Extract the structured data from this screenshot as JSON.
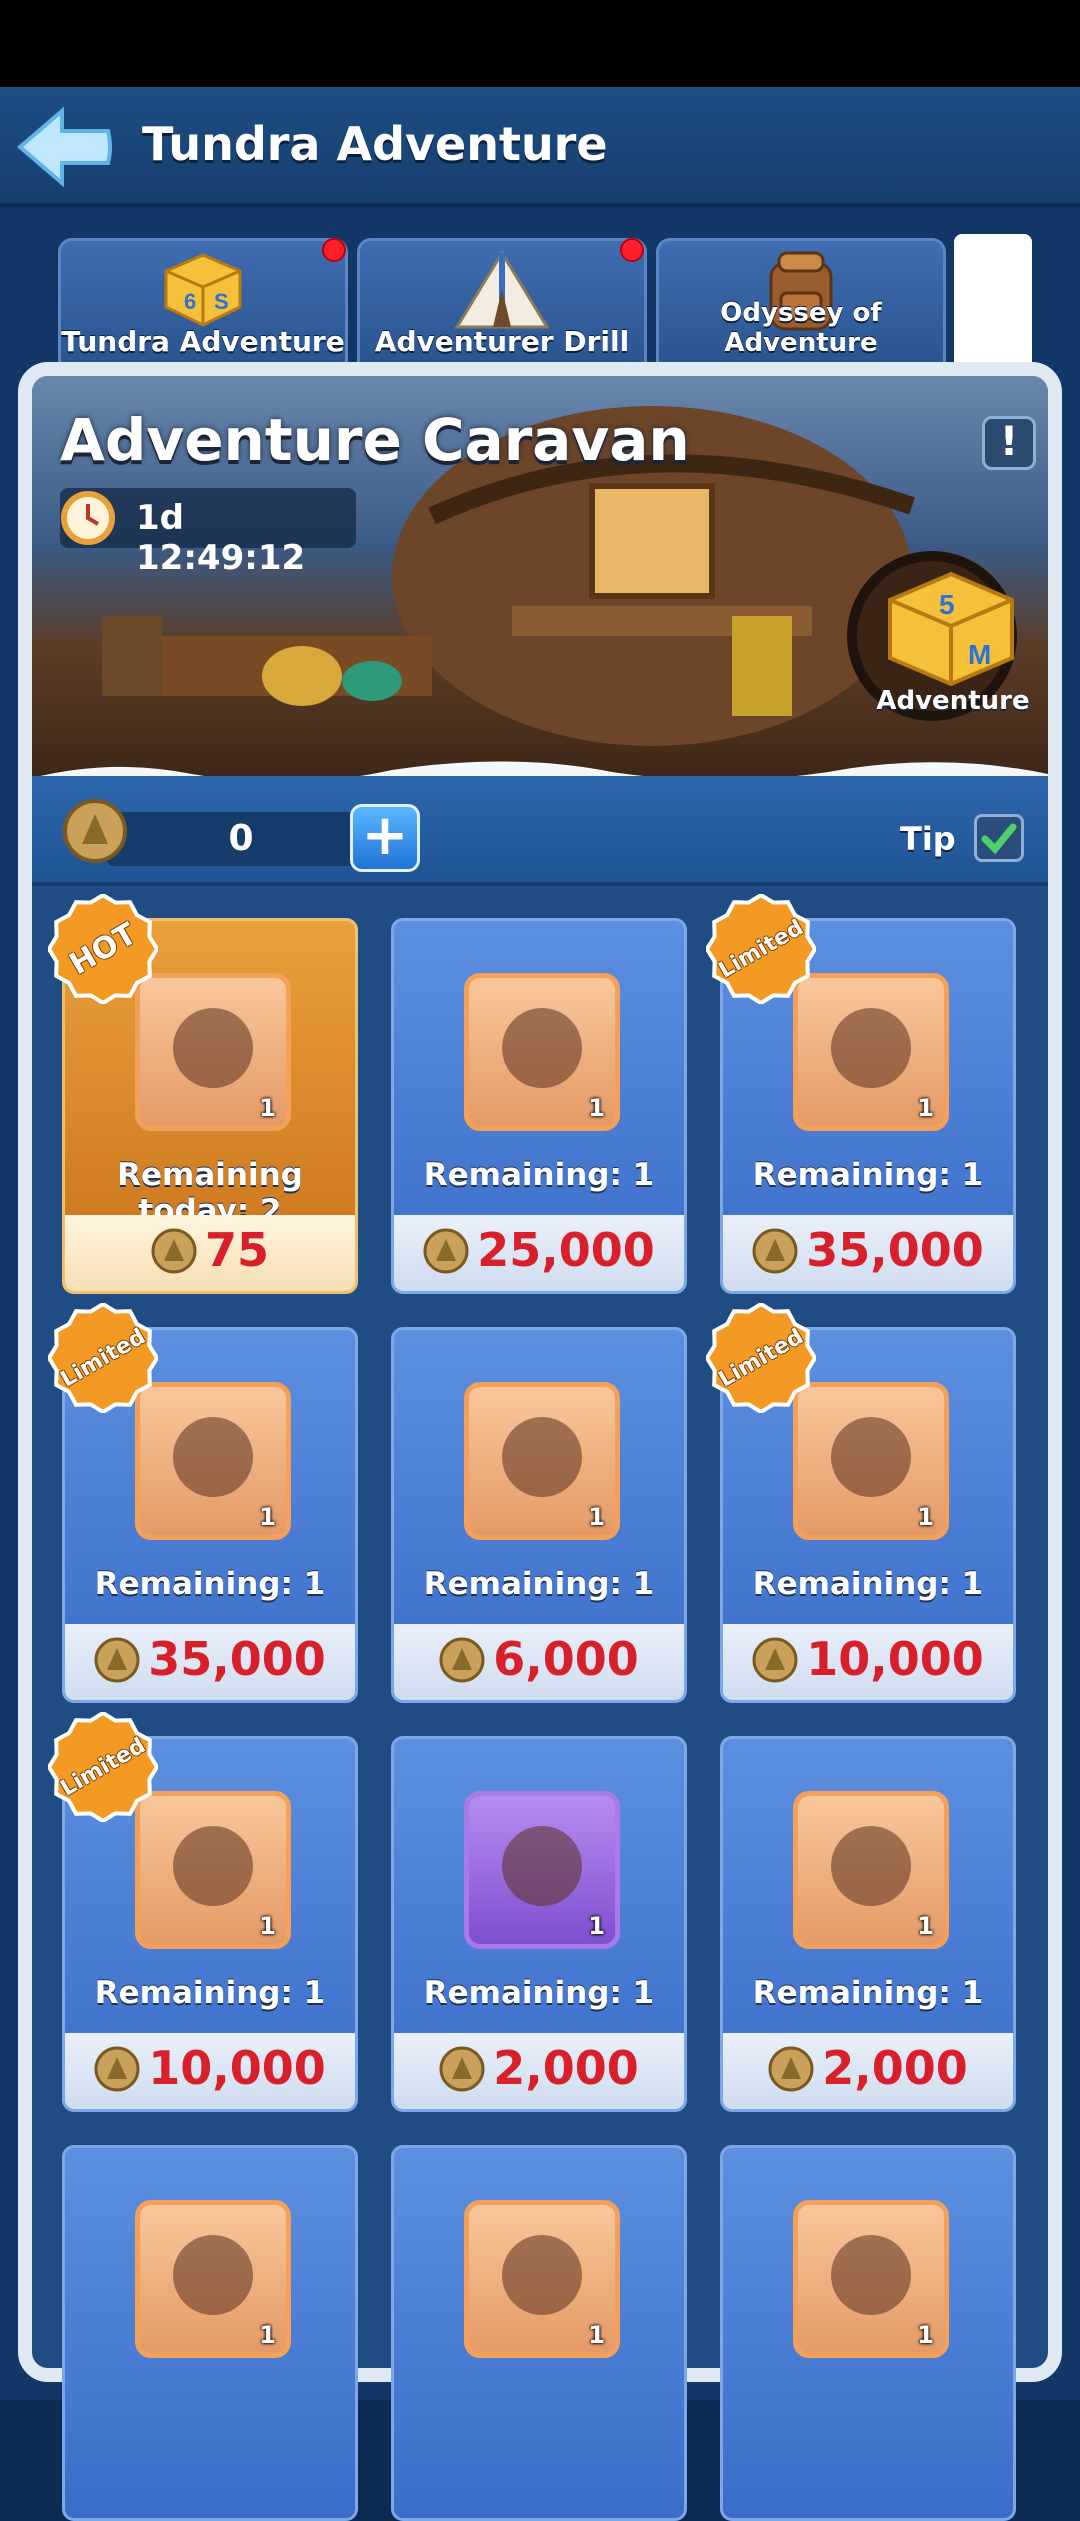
{
  "header": {
    "title": "Tundra Adventure"
  },
  "tabs": [
    {
      "label": "Tundra Adventure",
      "dot": true
    },
    {
      "label": "Adventurer Drill",
      "dot": true
    },
    {
      "label": "Odyssey of Adventure",
      "dot": false
    }
  ],
  "banner": {
    "title": "Adventure Caravan",
    "timer": "1d 12:49:12",
    "badge_label": "Adventure",
    "info_icon": "exclamation-icon"
  },
  "currency": {
    "value": "0",
    "tip_label": "Tip",
    "tip_checked": true
  },
  "items": [
    {
      "remaining": "Remaining today: 2",
      "price": "75",
      "qty": "1",
      "tag": "HOT",
      "style": "hot",
      "icon": "puzzle-piece-icon"
    },
    {
      "remaining": "Remaining: 1",
      "price": "25,000",
      "qty": "1",
      "tag": "",
      "style": "normal",
      "icon": "tower-icon"
    },
    {
      "remaining": "Remaining: 1",
      "price": "35,000",
      "qty": "1",
      "tag": "Limited",
      "style": "normal",
      "icon": "fortress-icon"
    },
    {
      "remaining": "Remaining: 1",
      "price": "35,000",
      "qty": "1",
      "tag": "Limited",
      "style": "normal",
      "icon": "mech-tower-icon"
    },
    {
      "remaining": "Remaining: 1",
      "price": "6,000",
      "qty": "1",
      "tag": "",
      "style": "normal",
      "icon": "raven-icon"
    },
    {
      "remaining": "Remaining: 1",
      "price": "10,000",
      "qty": "1",
      "tag": "Limited",
      "style": "normal",
      "icon": "egg-cart-icon"
    },
    {
      "remaining": "Remaining: 1",
      "price": "10,000",
      "qty": "1",
      "tag": "Limited",
      "style": "normal",
      "icon": "crab-mech-icon"
    },
    {
      "remaining": "Remaining: 1",
      "price": "2,000",
      "qty": "1",
      "tag": "",
      "style": "purple",
      "icon": "nameplate-icon"
    },
    {
      "remaining": "Remaining: 1",
      "price": "2,000",
      "qty": "1",
      "tag": "",
      "style": "normal",
      "icon": "frame-icon"
    },
    {
      "remaining": "",
      "price": "",
      "qty": "1",
      "tag": "",
      "style": "normal",
      "icon": "dwarf-icon"
    },
    {
      "remaining": "",
      "price": "",
      "qty": "1",
      "tag": "",
      "style": "normal",
      "icon": "hammer-stone-icon"
    },
    {
      "remaining": "",
      "price": "",
      "qty": "1",
      "tag": "",
      "style": "normal",
      "icon": "treasure-chest-icon"
    }
  ],
  "colors": {
    "accent_red": "#d8202a",
    "tag_orange": "#f39a24",
    "card_blue": "#4a7fd8"
  }
}
